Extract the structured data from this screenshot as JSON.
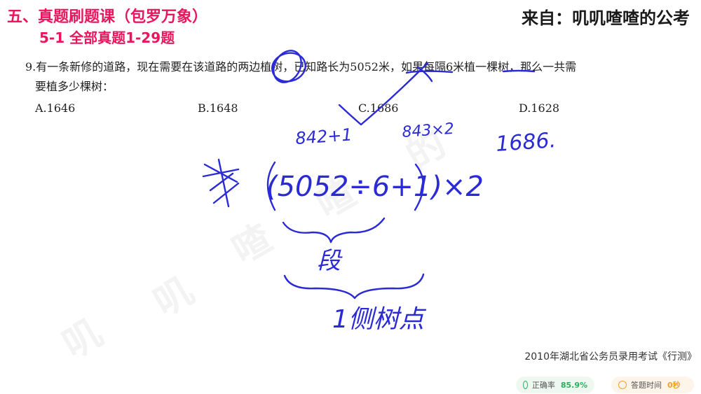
{
  "header": {
    "title": "五、真题刷题课（包罗万象）",
    "subtitle": "5-1 全部真题1-29题",
    "source": "来自：叽叽喳喳的公考"
  },
  "question": {
    "line1": "9.有一条新修的道路，现在需要在该道路的两边植树，已知路长为5052米，如果每隔6米植一棵树，那么一共需",
    "line2": "要植多少棵树：",
    "options": [
      {
        "label": "A.1646"
      },
      {
        "label": "B.1648"
      },
      {
        "label": "C.1686"
      },
      {
        "label": "D.1628"
      }
    ]
  },
  "handwriting": {
    "calc1": "842+1",
    "calc2": "843×2",
    "answer": "1686.",
    "formula": "(5052÷6+1)×2",
    "word_segment": "段",
    "word_side_trees": "1侧树点"
  },
  "footer": {
    "exam_source": "2010年湖北省公务员录用考试《行测》",
    "accuracy_label": "正确率",
    "accuracy_value": "85.9%",
    "time_label": "答题时间",
    "time_value": "0秒"
  },
  "colors": {
    "accent": "#e8175d",
    "ink": "#2b2bd6",
    "accuracy": "#2fae5f",
    "time": "#f0a030"
  },
  "watermark": [
    "叽",
    "叽",
    "喳",
    "喳",
    "的"
  ]
}
